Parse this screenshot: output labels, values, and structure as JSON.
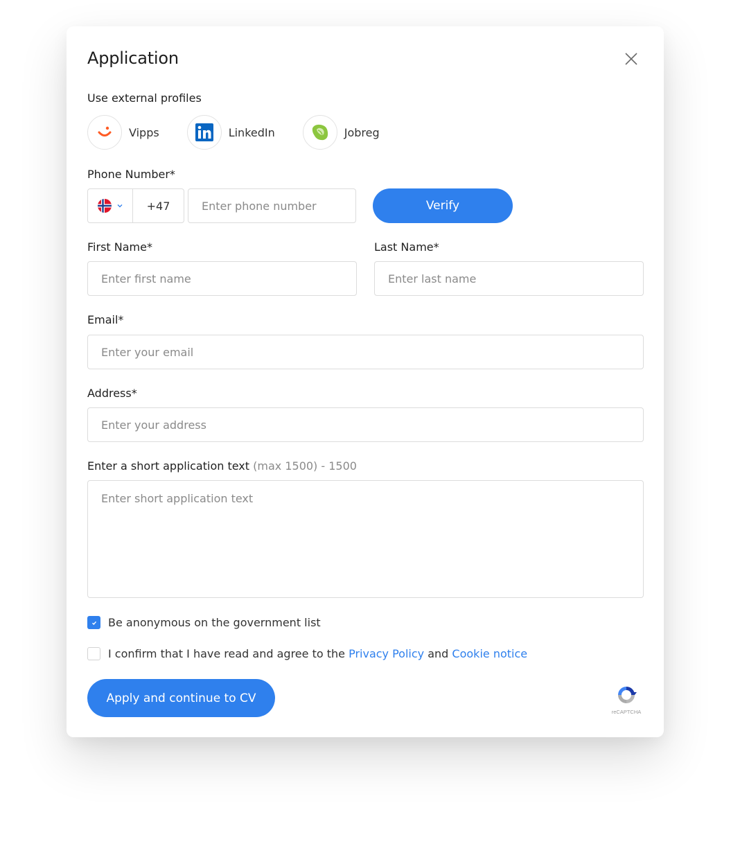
{
  "modal": {
    "title": "Application",
    "close_icon": "close-icon"
  },
  "external_profiles": {
    "label": "Use external profiles",
    "items": [
      {
        "label": "Vipps",
        "icon": "vipps-icon"
      },
      {
        "label": "LinkedIn",
        "icon": "linkedin-icon"
      },
      {
        "label": "Jobreg",
        "icon": "jobreg-icon"
      }
    ]
  },
  "phone": {
    "label": "Phone Number*",
    "country_flag": "norway-flag-icon",
    "country_code": "+47",
    "placeholder": "Enter phone number",
    "verify_label": "Verify"
  },
  "first_name": {
    "label": "First Name*",
    "placeholder": "Enter first name"
  },
  "last_name": {
    "label": "Last Name*",
    "placeholder": "Enter last name"
  },
  "email": {
    "label": "Email*",
    "placeholder": "Enter your email"
  },
  "address": {
    "label": "Address*",
    "placeholder": "Enter your address"
  },
  "application_text": {
    "label": "Enter a short application text",
    "hint": "(max 1500) - 1500",
    "placeholder": "Enter short application text"
  },
  "anonymous": {
    "label": "Be anonymous on the government list",
    "checked": true
  },
  "consent": {
    "prefix": "I confirm that I have read and agree to the",
    "privacy_link": "Privacy Policy",
    "and": "and",
    "cookie_link": "Cookie notice",
    "checked": false
  },
  "submit_label": "Apply and continue to CV",
  "recaptcha_label": "reCAPTCHA",
  "colors": {
    "accent": "#2f80ed",
    "vipps": "#ff5b24",
    "linkedin": "#0a66c2",
    "jobreg": "#8cc63f"
  }
}
